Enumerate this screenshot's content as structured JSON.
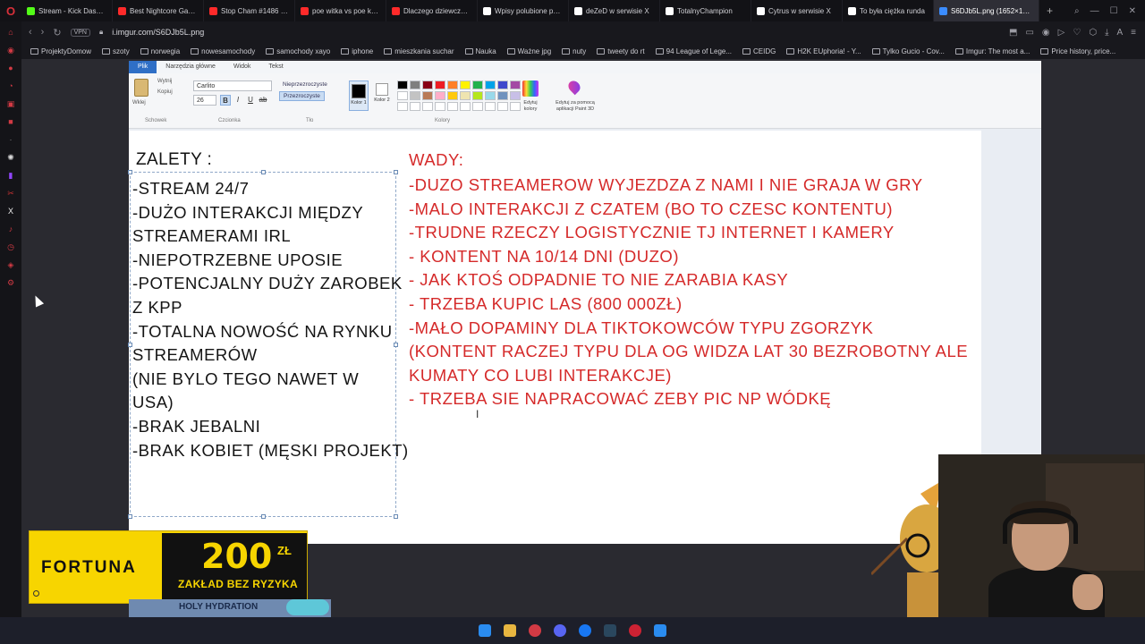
{
  "browser": {
    "tabs": [
      {
        "label": "Stream - Kick Dashbo",
        "color": "#53fc18"
      },
      {
        "label": "Best Nightcore Gamin",
        "color": "#ff2a2a"
      },
      {
        "label": "Stop Cham #1486 - N",
        "color": "#ff2a2a"
      },
      {
        "label": "poe witka vs poe kam",
        "color": "#ff2a2a"
      },
      {
        "label": "Dlaczego dziewczyny",
        "color": "#ff2a2a"
      },
      {
        "label": "Wpisy polubione prze",
        "color": "#ffffff"
      },
      {
        "label": "deZeD w serwisie X",
        "color": "#ffffff"
      },
      {
        "label": "TotalnyChampion",
        "color": "#ffffff"
      },
      {
        "label": "Cytrus w serwisie X",
        "color": "#ffffff"
      },
      {
        "label": "To była ciężka runda",
        "color": "#ffffff"
      },
      {
        "label": "S6DJb5L.png (1652×1007)",
        "color": "#3b8cff",
        "active": true
      }
    ],
    "vpn_label": "VPN",
    "url": "i.imgur.com/S6DJb5L.png"
  },
  "bookmarks": [
    {
      "label": "ProjektyDomow"
    },
    {
      "label": "szoty"
    },
    {
      "label": "norwegia"
    },
    {
      "label": "nowesamochody"
    },
    {
      "label": "samochody xayo"
    },
    {
      "label": "iphone"
    },
    {
      "label": "mieszkania suchar"
    },
    {
      "label": "Nauka"
    },
    {
      "label": "Ważne jpg"
    },
    {
      "label": "nuty"
    },
    {
      "label": "tweety do rt"
    },
    {
      "label": "94 League of Lege..."
    },
    {
      "label": "CEIDG"
    },
    {
      "label": "H2K EUphoria! - Y..."
    },
    {
      "label": "Tylko Gucio - Cov..."
    },
    {
      "label": "Imgur: The most a..."
    },
    {
      "label": "Price history, price..."
    }
  ],
  "paint": {
    "ribbon_tabs": [
      "Plik",
      "Narzędzia główne",
      "Widok",
      "Tekst"
    ],
    "clipboard": {
      "cut": "Wytnij",
      "copy": "Kopiuj",
      "paste": "Wklej",
      "group": "Schowek"
    },
    "font": {
      "name": "Carlito",
      "size": "26",
      "group": "Czcionka"
    },
    "background": {
      "opaque": "Nieprzezroczyste",
      "transparent": "Przezroczyste",
      "group": "Tło"
    },
    "colors": {
      "color1": "Kolor 1",
      "color2": "Kolor 2",
      "group": "Kolory",
      "edit": "Edytuj kolory",
      "paint3d": "Edytuj za pomocą aplikacji Paint 3D"
    },
    "palette": [
      "#000000",
      "#7f7f7f",
      "#880015",
      "#ed1c24",
      "#ff7f27",
      "#fff200",
      "#22b14c",
      "#00a2e8",
      "#3f48cc",
      "#a349a4",
      "#ffffff",
      "#c3c3c3",
      "#b97a57",
      "#ffaec9",
      "#ffc90e",
      "#efe4b0",
      "#b5e61d",
      "#99d9ea",
      "#7092be",
      "#c8bfe7",
      "#ffffff",
      "#ffffff",
      "#ffffff",
      "#ffffff",
      "#ffffff",
      "#ffffff",
      "#ffffff",
      "#ffffff",
      "#ffffff",
      "#ffffff"
    ]
  },
  "document": {
    "pros_title": "ZALETY :",
    "pros": [
      "-STREAM 24/7",
      "-DUŻO INTERAKCJI MIĘDZY",
      "STREAMERAMI IRL",
      "-NIEPOTRZEBNE UPOSIE",
      "-POTENCJALNY DUŻY ZAROBEK",
      "Z KPP",
      "-TOTALNA NOWOŚĆ NA RYNKU",
      "STREAMERÓW",
      "(NIE BYLO TEGO NAWET W",
      "USA)",
      "-BRAK JEBALNI",
      "-BRAK KOBIET (MĘSKI PROJEKT)"
    ],
    "cons_title": "WADY:",
    "cons": [
      "-DUZO STREAMEROW WYJEZDZA Z NAMI I NIE GRAJA W GRY",
      "-MALO INTERAKCJI Z CZATEM (BO TO CZESC KONTENTU)",
      "-TRUDNE RZECZY LOGISTYCZNIE TJ INTERNET I KAMERY",
      "-  KONTENT NA 10/14 DNI (DUZO)",
      "- JAK KTOŚ ODPADNIE TO NIE ZARABIA KASY",
      "- TRZEBA KUPIC LAS (800 000ZŁ)",
      "-MAŁO DOPAMINY DLA TIKTOKOWCÓW TYPU ZGORZYK",
      "(KONTENT RACZEJ TYPU DLA OG WIDZA LAT 30 BEZROBOTNY ALE",
      "KUMATY CO LUBI INTERAKCJE)",
      "- TRZEBA SIE NAPRACOWAĆ ZEBY PIC NP WÓDKĘ"
    ],
    "pros_color": "#141414",
    "cons_color": "#d52a2a"
  },
  "ad": {
    "brand": "FORTUNA",
    "amount": "200",
    "currency": "ZŁ",
    "tagline": "ZAKŁAD BEZ RYZYKA",
    "color": "#f7d500"
  },
  "thumbnail": {
    "text": "HOLY HYDRATION"
  }
}
